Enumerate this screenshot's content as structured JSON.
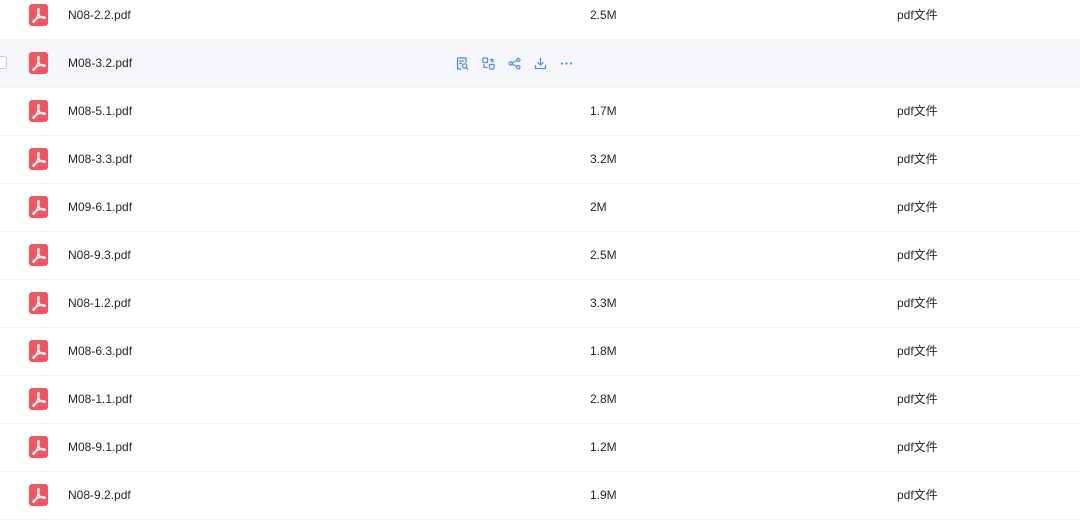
{
  "accent_color": "#4a8cf7",
  "pdf_icon_color": "#f4555f",
  "files": [
    {
      "name": "N08-2.2.pdf",
      "size": "2.5M",
      "type": "pdf文件"
    },
    {
      "name": "M08-3.2.pdf",
      "size": "",
      "type": "",
      "hovered": true
    },
    {
      "name": "M08-5.1.pdf",
      "size": "1.7M",
      "type": "pdf文件"
    },
    {
      "name": "M08-3.3.pdf",
      "size": "3.2M",
      "type": "pdf文件"
    },
    {
      "name": "M09-6.1.pdf",
      "size": "2M",
      "type": "pdf文件"
    },
    {
      "name": "N08-9.3.pdf",
      "size": "2.5M",
      "type": "pdf文件"
    },
    {
      "name": "N08-1.2.pdf",
      "size": "3.3M",
      "type": "pdf文件"
    },
    {
      "name": "M08-6.3.pdf",
      "size": "1.8M",
      "type": "pdf文件"
    },
    {
      "name": "M08-1.1.pdf",
      "size": "2.8M",
      "type": "pdf文件"
    },
    {
      "name": "M08-9.1.pdf",
      "size": "1.2M",
      "type": "pdf文件"
    },
    {
      "name": "N08-9.2.pdf",
      "size": "1.9M",
      "type": "pdf文件"
    }
  ],
  "row_actions": [
    {
      "icon": "preview-icon"
    },
    {
      "icon": "convert-icon"
    },
    {
      "icon": "share-icon"
    },
    {
      "icon": "download-icon"
    },
    {
      "icon": "more-icon"
    }
  ]
}
